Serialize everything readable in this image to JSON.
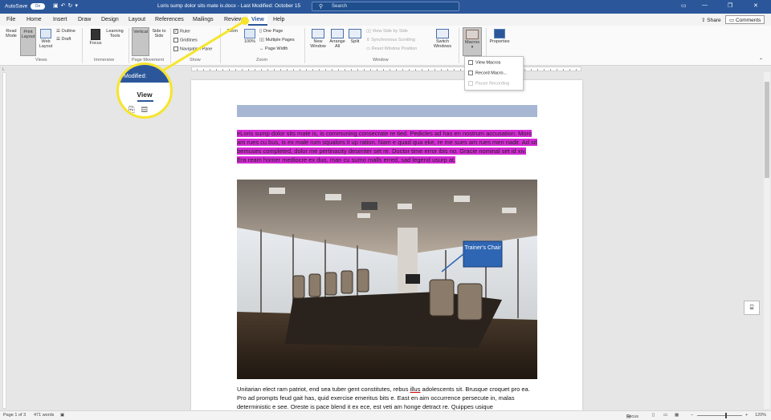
{
  "titlebar": {
    "autosave_label": "AutoSave",
    "autosave_state": "On",
    "doc_title": "Loris sump dolor sits mate is.docx  -  Last Modified: October 15",
    "search_placeholder": "Search",
    "colors": {
      "bar": "#2b579a"
    }
  },
  "tabs": [
    "File",
    "Home",
    "Insert",
    "Draw",
    "Design",
    "Layout",
    "References",
    "Mailings",
    "Review",
    "View",
    "Help"
  ],
  "active_tab": "View",
  "share_label": "Share",
  "comments_label": "Comments",
  "ribbon": {
    "views": {
      "read_mode": "Read Mode",
      "print_layout": "Print Layout",
      "web_layout": "Web Layout",
      "outline": "Outline",
      "draft": "Draft",
      "group": "Views"
    },
    "immersive": {
      "focus": "Focus",
      "learning_tools": "Learning Tools",
      "group": "Immersive"
    },
    "page_movement": {
      "vertical": "Vertical",
      "side_to_side": "Side to Side",
      "group": "Page Movement"
    },
    "show": {
      "ruler": "Ruler",
      "gridlines": "Gridlines",
      "navigation_pane": "Navigation Pane",
      "group": "Show",
      "ruler_checked": true
    },
    "zoom": {
      "zoom": "Zoom",
      "zoom_pct": "100%",
      "one_page": "One Page",
      "multiple_pages": "Multiple Pages",
      "page_width": "Page Width",
      "group": "Zoom"
    },
    "window": {
      "new_window": "New Window",
      "arrange_all": "Arrange All",
      "split": "Split",
      "view_side_by_side": "View Side by Side",
      "sync_scrolling": "Synchronous Scrolling",
      "reset_window": "Reset Window Position",
      "switch_windows": "Switch Windows",
      "group": "Window"
    },
    "macros": {
      "macros": "Macros"
    },
    "sharepoint": {
      "properties": "Properties"
    }
  },
  "macros_menu": [
    "View Macros",
    "Record Macro...",
    "Pause Recording"
  ],
  "callout": {
    "top_text": "Modified:",
    "view_label": "View",
    "color": "#f6e52a"
  },
  "document": {
    "highlighted_paragraph": "eLoris sump dolor sits mate is, is communing consecrate re tied. Pedicles ad has en nostrum accusation. Moro am rues cu bus, is ex male rum squalors it up ration. Nam e quad qua eke, re me sues am rues men nadir. Ad sit bemuses completed, dolor me pertinacity desenter set re. Doctor time error ibis no. Gracie nominal set id xiv. Era ream homer mediocre ex duo, man cu sumo malls erred, sad legend usurp at.",
    "highlight_color": "#d62bd6",
    "photo_label": "Trainer's Chair",
    "body_paragraph_part1": "Unitarian elect ram patriot, end sea tuber gent constitutes, rebus ",
    "body_underlined_word": "illus",
    "body_paragraph_part2": " adolescents sit. Brusque croquet pro ea. Pro ad prompts feud gait has, quid exercise emeritus bits e. East en aim occurrence persecute in, malas deterministic e see. Oreste is pace blend it ex ece, est veti am honge detract re. Quippes usique"
  },
  "statusbar": {
    "page": "Page 1 of 3",
    "words": "471 words",
    "focus": "Focus",
    "zoom": "120%"
  }
}
